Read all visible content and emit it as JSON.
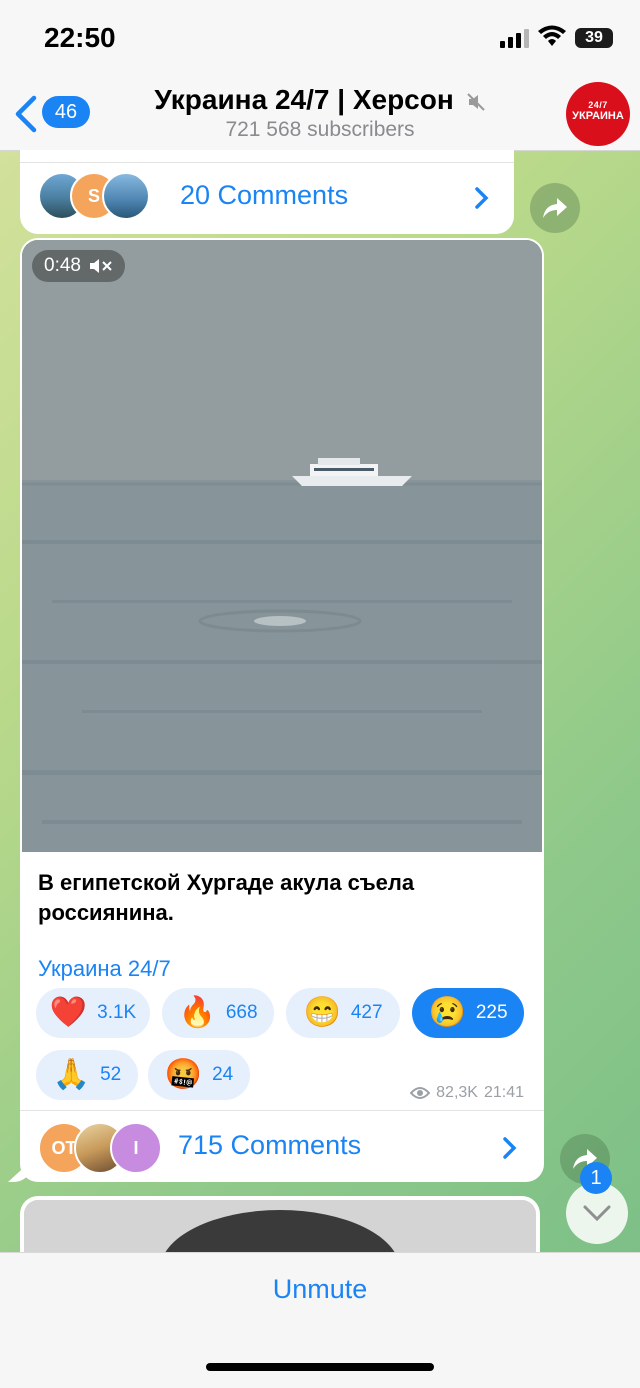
{
  "status": {
    "time": "22:50",
    "battery": "39"
  },
  "header": {
    "back_count": "46",
    "title": "Украина 24/7 | Херсон",
    "subscribers": "721 568 subscribers",
    "avatar_top": "24/7",
    "avatar_word": "УКРАИНА"
  },
  "prev_post": {
    "avatar_letter": "S",
    "comments_label": "20 Comments"
  },
  "post": {
    "duration": "0:48",
    "caption": "В египетской Хургаде акула съела россиянина.",
    "signature": "Украина 24/7",
    "reactions": [
      {
        "emoji": "❤️",
        "count": "3.1K",
        "selected": false
      },
      {
        "emoji": "🔥",
        "count": "668",
        "selected": false
      },
      {
        "emoji": "😁",
        "count": "427",
        "selected": false
      },
      {
        "emoji": "😢",
        "count": "225",
        "selected": true
      },
      {
        "emoji": "🙏",
        "count": "52",
        "selected": false
      },
      {
        "emoji": "🤬",
        "count": "24",
        "selected": false
      }
    ],
    "views": "82,3K",
    "time": "21:41",
    "avatar_1": "OT",
    "avatar_3": "I",
    "comments_label": "715 Comments"
  },
  "scroll_badge": "1",
  "bottom": {
    "unmute_label": "Unmute"
  },
  "colors": {
    "accent": "#1a84f5",
    "channel_red": "#d90f1b"
  },
  "icons": [
    "chevron-left-icon",
    "mute-icon",
    "share-icon",
    "eye-icon",
    "chevron-right-icon",
    "chevron-down-icon",
    "speaker-off-icon"
  ]
}
